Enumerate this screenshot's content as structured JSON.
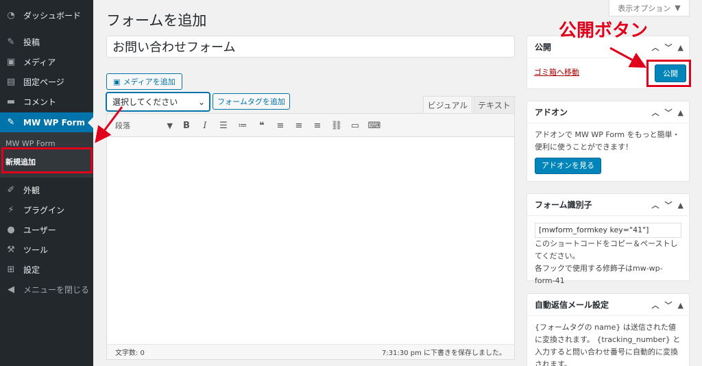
{
  "sidebar": {
    "items": [
      {
        "label": "ダッシュボード",
        "icon": "dashboard-icon"
      },
      {
        "label": "投稿",
        "icon": "pin-icon"
      },
      {
        "label": "メディア",
        "icon": "media-icon"
      },
      {
        "label": "固定ページ",
        "icon": "page-icon"
      },
      {
        "label": "コメント",
        "icon": "comment-icon"
      },
      {
        "label": "MW WP Form",
        "icon": "pin-icon"
      },
      {
        "label": "外観",
        "icon": "brush-icon"
      },
      {
        "label": "プラグイン",
        "icon": "plugin-icon"
      },
      {
        "label": "ユーザー",
        "icon": "user-icon"
      },
      {
        "label": "ツール",
        "icon": "wrench-icon"
      },
      {
        "label": "設定",
        "icon": "settings-icon"
      },
      {
        "label": "メニューを閉じる",
        "icon": "collapse-icon"
      }
    ],
    "submenu": [
      "MW WP Form",
      "新規追加"
    ]
  },
  "header": {
    "title": "フォームを追加",
    "screen_options": "表示オプション"
  },
  "form": {
    "title_value": "お問い合わせフォーム",
    "add_media": "メディアを追加",
    "select_value": "選択してください",
    "add_form_tag": "フォームタグを追加",
    "tab_visual": "ビジュアル",
    "tab_text": "テキスト",
    "format_value": "段落",
    "word_count": "文字数: 0",
    "draft_saved": "7:31:30 pm に下書きを保存しました。"
  },
  "boxes": {
    "publish": {
      "title": "公開",
      "trash": "ゴミ箱へ移動",
      "button": "公開"
    },
    "addon": {
      "title": "アドオン",
      "text": "アドオンで MW WP Form をもっと簡単・便利に使うことができます！",
      "button": "アドオンを見る"
    },
    "formkey": {
      "title": "フォーム識別子",
      "value": "[mwform_formkey key=\"41\"]",
      "text1": "このショートコードをコピー＆ペーストしてください。",
      "text2": "各フックで使用する修飾子はmw-wp-form-41"
    },
    "automail": {
      "title": "自動返信メール設定",
      "text": "{フォームタグの name} は送信された値に変換されます。 {tracking_number} と入力すると問い合わせ番号に自動的に変換されます。"
    }
  },
  "annotation": {
    "label": "公開ボタン",
    "color": "#e1001b"
  },
  "colors": {
    "sidebar": "#23282d",
    "active": "#0073aa",
    "primary": "#0085ba"
  }
}
